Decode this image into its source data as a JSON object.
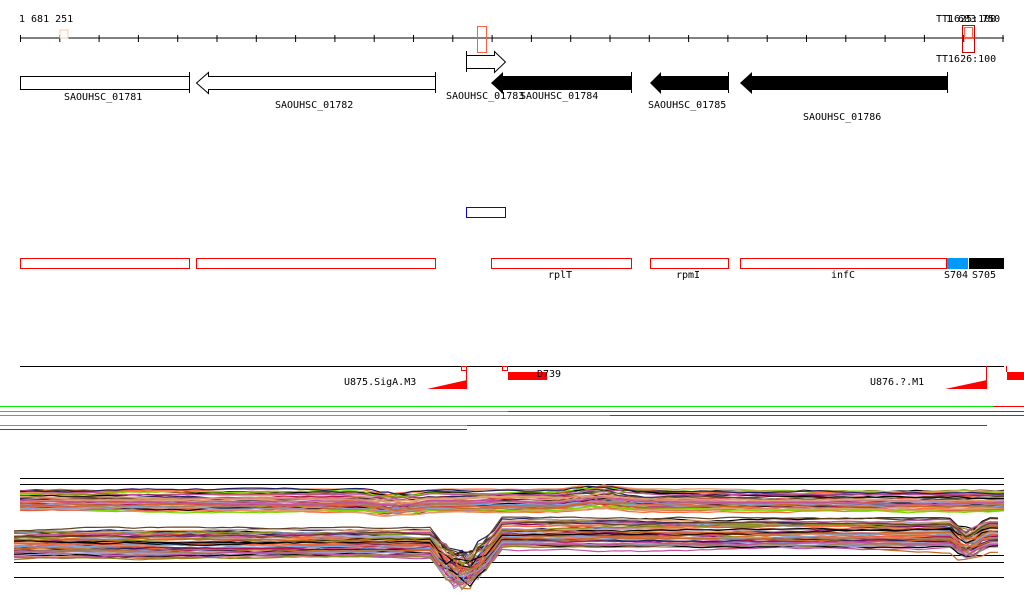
{
  "ruler": {
    "start_label": "1 681 251",
    "end_label": "1 683 750",
    "terminator_top_label": "TT1625:100",
    "terminator_bottom_label": "TT1626:100"
  },
  "genes": [
    {
      "label": "SAOUHSC_01781",
      "strand": "none",
      "filled": false
    },
    {
      "label": "SAOUHSC_01782",
      "strand": "-",
      "filled": false
    },
    {
      "label": "SAOUHSC_01783",
      "strand": "+",
      "filled": false
    },
    {
      "label": "SAOUHSC_01784",
      "strand": "-",
      "filled": true
    },
    {
      "label": "SAOUHSC_01785",
      "strand": "-",
      "filled": true
    },
    {
      "label": "SAOUHSC_01786",
      "strand": "-",
      "filled": true
    }
  ],
  "features": [
    {
      "label": "",
      "color": "#ff0000"
    },
    {
      "label": "",
      "color": "#ff0000"
    },
    {
      "label": "rplT",
      "color": "#ff0000"
    },
    {
      "label": "rpmI",
      "color": "#ff0000"
    },
    {
      "label": "infC",
      "color": "#ff0000"
    },
    {
      "label": "S704",
      "color": "#0099ff"
    },
    {
      "label": "S705",
      "color": "#000000"
    }
  ],
  "promoters": [
    {
      "label": "U875.SigA.M3"
    },
    {
      "label": "D739"
    },
    {
      "label": "U876.?.M1"
    }
  ],
  "colors": {
    "gene_outline": "#000000",
    "feature_red": "#ff0000",
    "blue_box": "#0000ff",
    "expressed": "#00ee00",
    "not_expressed": "#ff0000",
    "trace_palette": [
      "#c46a1e",
      "#8b8b1a",
      "#7dd600",
      "#b8144a",
      "#8a0a6a",
      "#e06040",
      "#6fb0f0",
      "#c050a0",
      "#a08060",
      "#202060",
      "#d08080",
      "#9a9ad0",
      "#ff6a3a",
      "#604020",
      "#000000",
      "#e0a070"
    ]
  }
}
